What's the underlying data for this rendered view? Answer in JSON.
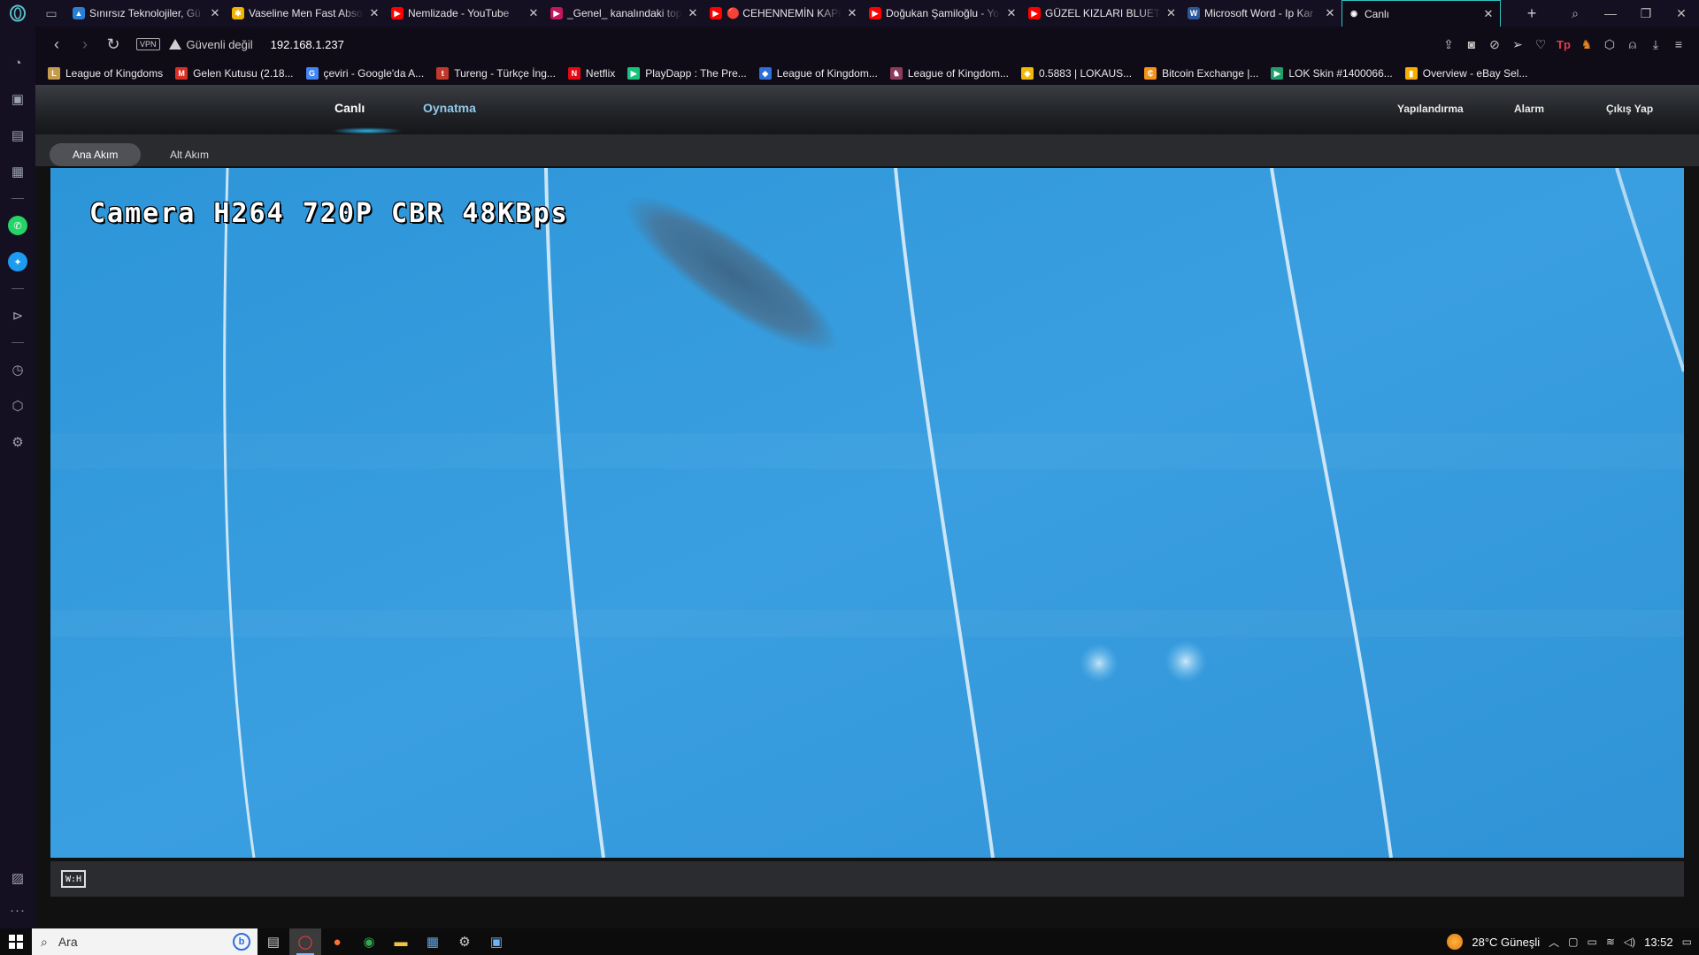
{
  "browser": {
    "tabs": [
      {
        "title": "Sınırsız Teknolojiler, Gü",
        "favicon_color": "#2a7fd4",
        "favicon_glyph": "▲"
      },
      {
        "title": "Vaseline Men Fast Abso",
        "favicon_color": "#f0b400",
        "favicon_glyph": "✱"
      },
      {
        "title": "Nemlizade - YouTube",
        "favicon_color": "#ff0000",
        "favicon_glyph": "▶"
      },
      {
        "title": "_Genel_ kanalındaki top",
        "favicon_color": "#c2185b",
        "favicon_glyph": "▶"
      },
      {
        "title": "🔴 CEHENNEMİN KAPI",
        "favicon_color": "#ff0000",
        "favicon_glyph": "▶"
      },
      {
        "title": "Doğukan Şamiloğlu - Yo",
        "favicon_color": "#ff0000",
        "favicon_glyph": "▶"
      },
      {
        "title": "GÜZEL KIZLARI BLUETO",
        "favicon_color": "#ff0000",
        "favicon_glyph": "▶"
      },
      {
        "title": "Microsoft Word - Ip Kar",
        "favicon_color": "#2b579a",
        "favicon_glyph": "W"
      },
      {
        "title": "Canlı",
        "favicon_color": "#ffffff",
        "favicon_glyph": "◉",
        "active": true
      }
    ],
    "address": {
      "vpn_label": "VPN",
      "security_text": "Güvenli değil",
      "url": "192.168.1.237"
    },
    "bookmarks": [
      {
        "label": "League of Kingdoms",
        "color": "#c59b4e",
        "glyph": "L"
      },
      {
        "label": "Gelen Kutusu (2.18...",
        "color": "#d93025",
        "glyph": "M"
      },
      {
        "label": "çeviri - Google'da A...",
        "color": "#4285f4",
        "glyph": "G"
      },
      {
        "label": "Tureng - Türkçe İng...",
        "color": "#c0392b",
        "glyph": "t"
      },
      {
        "label": "Netflix",
        "color": "#e50914",
        "glyph": "N"
      },
      {
        "label": "PlayDapp : The Pre...",
        "color": "#19c37d",
        "glyph": "▶"
      },
      {
        "label": "League of Kingdom...",
        "color": "#2d6fd6",
        "glyph": "◆"
      },
      {
        "label": "League of Kingdom...",
        "color": "#8e3b5d",
        "glyph": "♞"
      },
      {
        "label": "0.5883 | LOKAUS...",
        "color": "#f0b90b",
        "glyph": "◆"
      },
      {
        "label": "Bitcoin Exchange |...",
        "color": "#f7931a",
        "glyph": "₵"
      },
      {
        "label": "LOK Skin #1400066...",
        "color": "#22a06b",
        "glyph": "▶"
      },
      {
        "label": "Overview - eBay Sel...",
        "color": "#f5af02",
        "glyph": "▮"
      }
    ]
  },
  "sidebar": {
    "icons": [
      "speed-dial-icon",
      "shopping-bag-icon",
      "twitch-icon",
      "wallet-icon",
      "whatsapp-icon",
      "twitter-icon",
      "player-icon",
      "history-icon",
      "extensions-icon",
      "settings-icon"
    ]
  },
  "app": {
    "nav": {
      "live": "Canlı",
      "playback": "Oynatma",
      "config": "Yapılandırma",
      "alarm": "Alarm",
      "logout": "Çıkış Yap"
    },
    "streams": {
      "main": "Ana Akım",
      "sub": "Alt Akım"
    },
    "osd_text": "Camera H264 720P CBR 48KBps",
    "ratio_label": "W:H"
  },
  "taskbar": {
    "search_placeholder": "Ara",
    "bing_label": "b",
    "weather": "28°C Güneşli",
    "time": "13:52"
  }
}
